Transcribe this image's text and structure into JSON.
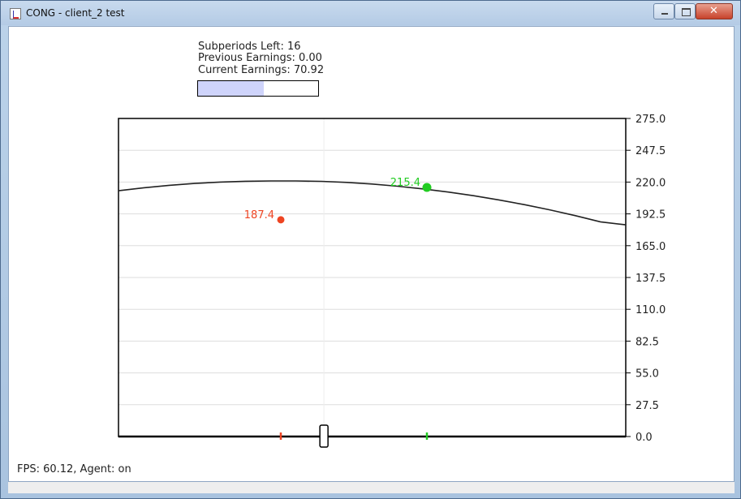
{
  "window": {
    "title": "CONG - client_2 test",
    "minimize_icon": "minimize-icon",
    "maximize_icon": "maximize-icon",
    "close_icon": "close-icon",
    "close_glyph": "✕"
  },
  "info": {
    "subperiods": "Subperiods Left: 16",
    "previous": "Previous Earnings: 0.00",
    "current": "Current Earnings: 70.92",
    "progress_fraction": 0.55,
    "progress_color": "#cfd4fb"
  },
  "footer": {
    "fps": "FPS: 60.12, Agent: on"
  },
  "chart_data": {
    "type": "line",
    "ylim": [
      0,
      275
    ],
    "y_ticks": [
      "275.0",
      "247.5",
      "220.0",
      "192.5",
      "165.0",
      "137.5",
      "110.0",
      "82.5",
      "55.0",
      "27.5",
      "0.0"
    ],
    "x_range": [
      0,
      1
    ],
    "grid": true,
    "curve": {
      "color": "#222222",
      "points": [
        [
          0.0,
          212.5
        ],
        [
          0.05,
          215.1
        ],
        [
          0.1,
          217.2
        ],
        [
          0.15,
          218.8
        ],
        [
          0.2,
          220.0
        ],
        [
          0.25,
          220.7
        ],
        [
          0.3,
          221.0
        ],
        [
          0.35,
          221.0
        ],
        [
          0.4,
          220.6
        ],
        [
          0.45,
          219.7
        ],
        [
          0.5,
          218.3
        ],
        [
          0.55,
          216.4
        ],
        [
          0.6,
          214.1
        ],
        [
          0.65,
          211.4
        ],
        [
          0.7,
          208.2
        ],
        [
          0.75,
          204.6
        ],
        [
          0.8,
          200.5
        ],
        [
          0.85,
          196.0
        ],
        [
          0.9,
          191.0
        ],
        [
          0.95,
          185.6
        ],
        [
          1.0,
          183.0
        ]
      ]
    },
    "markers": [
      {
        "name": "red-player",
        "x": 0.32,
        "y": 187.4,
        "label": "187.4",
        "color": "#ee4422"
      },
      {
        "name": "green-player",
        "x": 0.608,
        "y": 215.4,
        "label": "215.4",
        "color": "#22cc22"
      }
    ],
    "slider_x": 0.405
  }
}
